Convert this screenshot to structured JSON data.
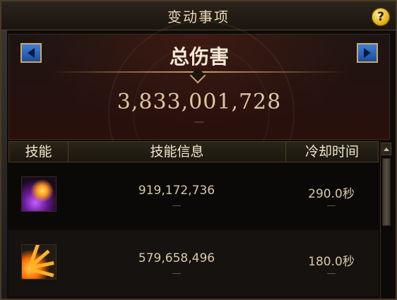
{
  "window": {
    "title": "变动事项",
    "help_label": "?"
  },
  "hero": {
    "label": "总伤害",
    "total_damage": "3,833,001,728",
    "sub": "—"
  },
  "table": {
    "headers": [
      "技能",
      "技能信息",
      "冷却时间"
    ],
    "rows": [
      {
        "icon": "purple-burst-skill-icon",
        "damage": "919,172,736",
        "damage_sub": "—",
        "cooldown": "290.0秒",
        "cooldown_sub": "—"
      },
      {
        "icon": "fire-fan-skill-icon",
        "damage": "579,658,496",
        "damage_sub": "—",
        "cooldown": "180.0秒",
        "cooldown_sub": "—"
      }
    ]
  },
  "colors": {
    "accent_gold": "#c6a46a",
    "arrow_blue": "#3d7fd6",
    "help_yellow": "#e0a800"
  }
}
